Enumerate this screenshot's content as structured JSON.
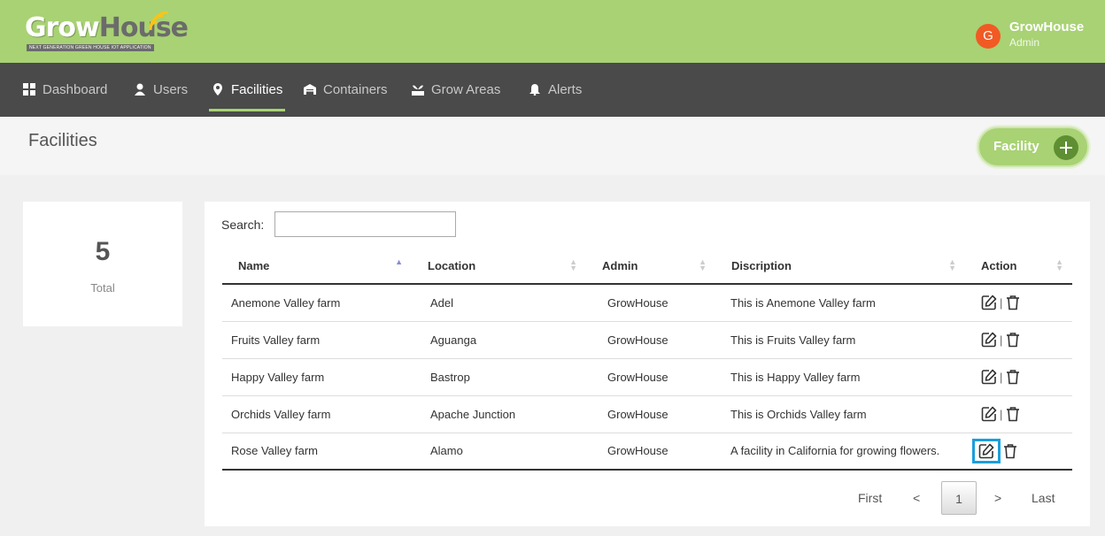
{
  "app": {
    "logo_main": "Grow",
    "logo_accent": "House",
    "logo_tagline": "NEXT GENERATION GREEN HOUSE IOT APPLICATION",
    "brand_color": "#a8d273",
    "nav_color": "#4a4a4a"
  },
  "user": {
    "initial": "G",
    "name": "GrowHouse",
    "role": "Admin"
  },
  "nav": {
    "items": [
      {
        "label": "Dashboard",
        "icon": "dashboard-icon"
      },
      {
        "label": "Users",
        "icon": "user-icon"
      },
      {
        "label": "Facilities",
        "icon": "location-pin-icon",
        "active": true
      },
      {
        "label": "Containers",
        "icon": "container-icon"
      },
      {
        "label": "Grow Areas",
        "icon": "grow-area-icon"
      },
      {
        "label": "Alerts",
        "icon": "bell-icon"
      }
    ]
  },
  "page": {
    "title": "Facilities",
    "add_label": "Facility"
  },
  "summary": {
    "total_value": "5",
    "total_label": "Total"
  },
  "table": {
    "search_label": "Search:",
    "search_value": "",
    "columns": [
      "Name",
      "Location",
      "Admin",
      "Discription",
      "Action"
    ],
    "rows": [
      {
        "name": "Anemone Valley farm",
        "location": "Adel",
        "admin": "GrowHouse",
        "description": "This is Anemone Valley farm"
      },
      {
        "name": "Fruits Valley farm",
        "location": "Aguanga",
        "admin": "GrowHouse",
        "description": "This is Fruits Valley farm"
      },
      {
        "name": "Happy Valley farm",
        "location": "Bastrop",
        "admin": "GrowHouse",
        "description": "This is Happy Valley farm"
      },
      {
        "name": "Orchids Valley farm",
        "location": "Apache Junction",
        "admin": "GrowHouse",
        "description": "This is Orchids Valley farm"
      },
      {
        "name": "Rose Valley farm",
        "location": "Alamo",
        "admin": "GrowHouse",
        "description": "A facility in California for growing flowers."
      }
    ],
    "action_separator": "|"
  },
  "pagination": {
    "first": "First",
    "prev": "<",
    "current": "1",
    "next": ">",
    "last": "Last"
  }
}
